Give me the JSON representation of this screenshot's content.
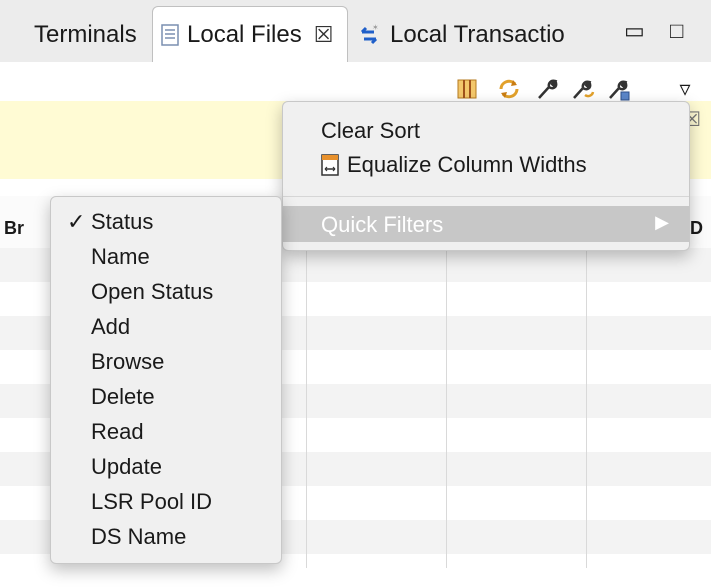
{
  "tabs": {
    "terminals": "Terminals",
    "local_files": "Local Files",
    "local_files_close": "☒",
    "local_transactions": "Local Transactio"
  },
  "window_controls": {
    "minimize": "▭",
    "maximize": "□"
  },
  "toolbar": {
    "icons": [
      "columns-icon",
      "refresh-icon",
      "wrench-icon",
      "wrench-refresh-icon",
      "wrench-save-icon",
      "view-menu-icon"
    ],
    "view_menu": "▿"
  },
  "message_band": {
    "close": "☒"
  },
  "table": {
    "header_partial_left": "Br",
    "header_partial_right": "D"
  },
  "toolbar_menu": {
    "clear_sort": "Clear Sort",
    "equalize": "Equalize Column Widths",
    "quick_filters": "Quick Filters",
    "submenu_arrow": "▶"
  },
  "column_menu": {
    "checkmark": "✓",
    "items": [
      "Status",
      "Name",
      "Open Status",
      "Add",
      "Browse",
      "Delete",
      "Read",
      "Update",
      "LSR Pool ID",
      "DS Name"
    ]
  },
  "colors": {
    "band": "#fffbd4",
    "hover": "#c7c7c7",
    "menu_bg": "#f0f0f0"
  }
}
